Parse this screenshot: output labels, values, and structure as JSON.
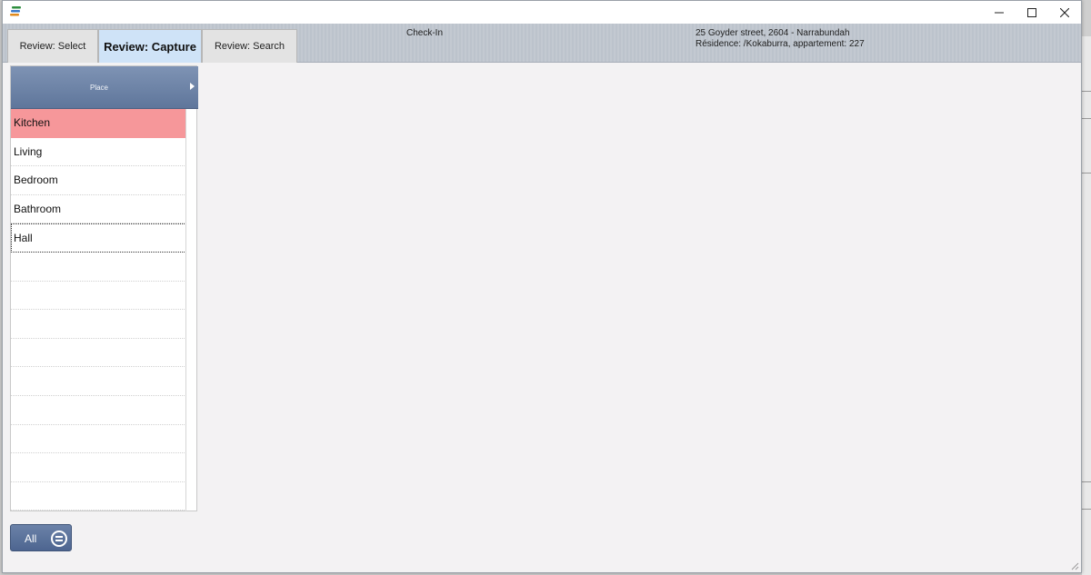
{
  "window": {
    "controls": {
      "minimize": "—",
      "maximize": "☐",
      "close": "✕"
    }
  },
  "tabs": [
    {
      "label": "Review: Select",
      "active": false
    },
    {
      "label": "Review: Capture",
      "active": true
    },
    {
      "label": "Review: Search",
      "active": false
    }
  ],
  "header": {
    "center": "Check-In",
    "address": "25 Goyder street, 2604 - Narrabundah",
    "residence": "Résidence: /Kokaburra, appartement: 227"
  },
  "grid": {
    "column": "Place",
    "rows": [
      "Kitchen",
      "Living",
      "Bedroom",
      "Bathroom",
      "Hall",
      "",
      "",
      "",
      "",
      "",
      "",
      "",
      "",
      ""
    ],
    "selected_index": 0,
    "focused_index": 4
  },
  "filter_button": {
    "label": "All"
  },
  "colors": {
    "selected_row": "#f6979a",
    "active_tab": "#cfe3f7",
    "grid_header": "#6b82a8"
  }
}
